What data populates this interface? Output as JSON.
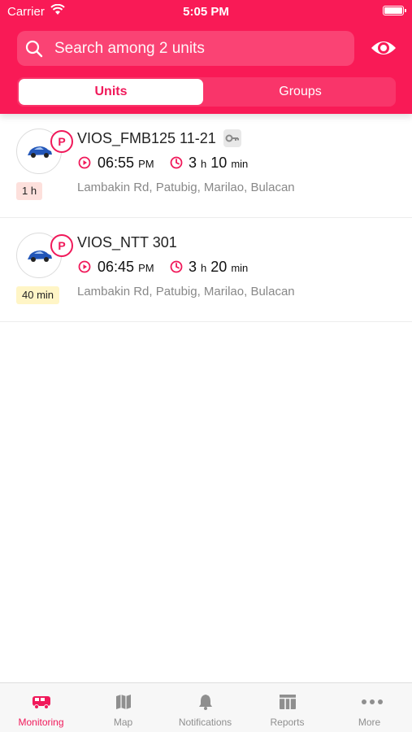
{
  "status_bar": {
    "carrier": "Carrier",
    "time": "5:05 PM"
  },
  "search": {
    "placeholder": "Search among 2 units"
  },
  "segments": {
    "active": "Units",
    "inactive": "Groups"
  },
  "units": [
    {
      "name": "VIOS_FMB125 11-21",
      "has_key": true,
      "badge": "P",
      "time": "06:55",
      "time_suffix": "PM",
      "dur_h": "3",
      "dur_h_unit": "h",
      "dur_m": "10",
      "dur_m_unit": "min",
      "address": "Lambakin Rd, Patubig, Marilao, Bulacan",
      "age": "1 h",
      "age_color": "#fde0dc"
    },
    {
      "name": "VIOS_NTT 301",
      "has_key": false,
      "badge": "P",
      "time": "06:45",
      "time_suffix": "PM",
      "dur_h": "3",
      "dur_h_unit": "h",
      "dur_m": "20",
      "dur_m_unit": "min",
      "address": "Lambakin Rd, Patubig, Marilao, Bulacan",
      "age": "40 min",
      "age_color": "#fff5c6"
    }
  ],
  "tabbar": [
    {
      "label": "Monitoring",
      "icon": "bus-icon",
      "active": true
    },
    {
      "label": "Map",
      "icon": "map-icon",
      "active": false
    },
    {
      "label": "Notifications",
      "icon": "bell-icon",
      "active": false
    },
    {
      "label": "Reports",
      "icon": "table-icon",
      "active": false
    },
    {
      "label": "More",
      "icon": "ellipsis-icon",
      "active": false
    }
  ],
  "colors": {
    "accent": "#f91a56",
    "accent_text": "#f0195a",
    "muted": "#888888"
  }
}
